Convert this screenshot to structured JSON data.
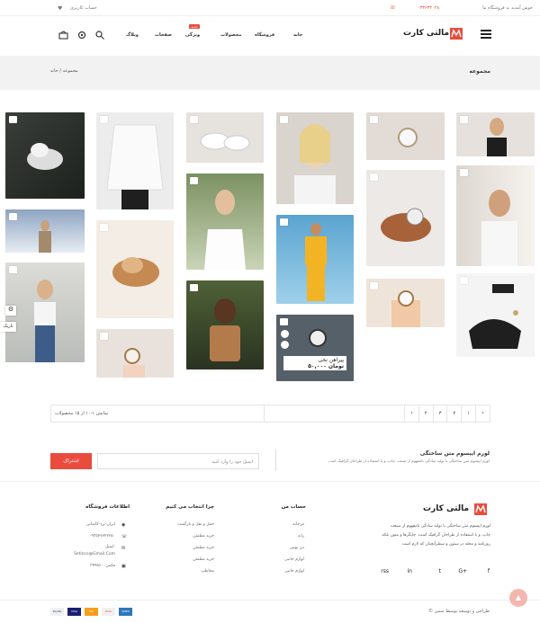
{
  "topbar": {
    "welcome": "خوش آمدید به فروشگاه ما",
    "phone": "۰۳۳۶۳۲۰۲۸",
    "account": "حساب کاربری"
  },
  "header": {
    "logo": "مالتی کارت",
    "nav": [
      "خانه",
      "فروشگاه",
      "محصولات",
      "ویژگی",
      "صفحات",
      "وبلاگ"
    ],
    "badge": "جدید"
  },
  "breadcrumb": {
    "title": "مجموعه",
    "home": "خانه",
    "sep": "/",
    "current": "مجموعه"
  },
  "side_tools": {
    "label": "تاریک"
  },
  "products": [
    {
      "title": "پیراهن نخی",
      "price": "۵۰,۰۰۰ تومان"
    }
  ],
  "pagination": {
    "summary": "نمایش ۱-۱۰ از ۱۵ محصولات",
    "pages": [
      "۱",
      "۲",
      "۳",
      "۴"
    ]
  },
  "newsletter": {
    "title": "لورم ایپسوم متن ساختگی",
    "text": "لورم ایپسوم متن ساختگی با تولید سادگی نامفهوم از صنعت چاپ، و با استفاده از طراحان گرافیک است",
    "placeholder": "ایمیل خود را وارد کنید",
    "button": "اشتراک"
  },
  "footer": {
    "logo": "مالتی کارت",
    "about": [
      "لورم ایپسوم متن ساختگی با تولید سادگی نامفهوم از صنعت",
      "چاپ، و با استفاده از طراحان گرافیک است. چاپگرها و متون بلکه",
      "روزنامه و مجله در ستون و سطرآنچنان که لازم است"
    ],
    "account_title": "حساب من",
    "account_items": [
      "مرجانه",
      "رانه",
      "دن پوش",
      "لوازم جانبی",
      "لوازم جانبی"
    ],
    "why_title": "چرا انتخاب می کنیم",
    "why_items": [
      "حمل و نقل و بازگشت",
      "خرید مطمئن",
      "خرید مطمئن",
      "خرید مطمئن",
      "مخاطب"
    ],
    "info_title": "اطلاعات فروشگاه",
    "info_items": [
      "ایران-یزد-کاشانی",
      "۰۹۳۵۷۷۷۲۲۶۵۰",
      "ایمیل:",
      "Setinco@Gmail.Com",
      "فکس: ۳۴۴۵۶۰"
    ],
    "social": [
      "f",
      "G+",
      "t",
      "in",
      "rss"
    ],
    "copyright": "© طراحی و توسعه توسط ستین"
  },
  "payments": [
    "PayPal",
    "VISA",
    "MC",
    "DISC",
    "AMEX"
  ],
  "colors": {
    "accent": "#e94c3d",
    "dark": "#222222"
  }
}
